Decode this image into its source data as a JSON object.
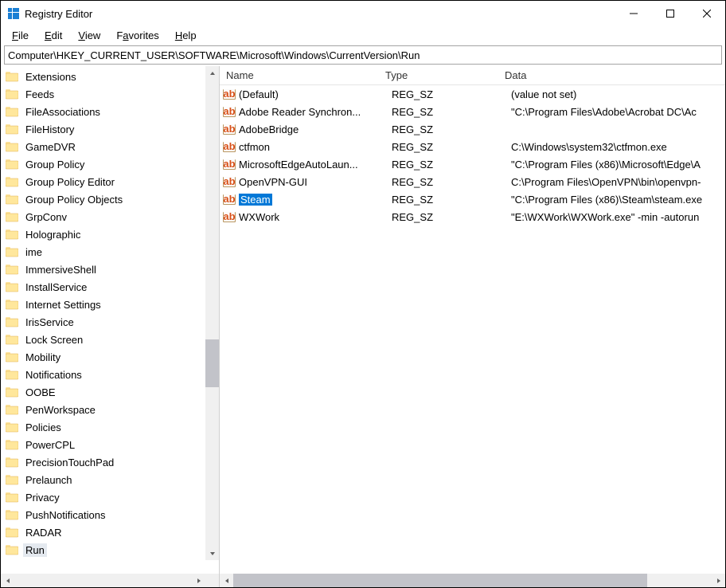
{
  "window": {
    "title": "Registry Editor"
  },
  "menu": {
    "file": "File",
    "edit": "Edit",
    "view": "View",
    "favorites": "Favorites",
    "help": "Help"
  },
  "address": "Computer\\HKEY_CURRENT_USER\\SOFTWARE\\Microsoft\\Windows\\CurrentVersion\\Run",
  "columns": {
    "name": "Name",
    "type": "Type",
    "data": "Data"
  },
  "tree": [
    {
      "label": "Extensions"
    },
    {
      "label": "Feeds"
    },
    {
      "label": "FileAssociations"
    },
    {
      "label": "FileHistory"
    },
    {
      "label": "GameDVR"
    },
    {
      "label": "Group Policy"
    },
    {
      "label": "Group Policy Editor"
    },
    {
      "label": "Group Policy Objects"
    },
    {
      "label": "GrpConv"
    },
    {
      "label": "Holographic"
    },
    {
      "label": "ime"
    },
    {
      "label": "ImmersiveShell"
    },
    {
      "label": "InstallService"
    },
    {
      "label": "Internet Settings"
    },
    {
      "label": "IrisService"
    },
    {
      "label": "Lock Screen"
    },
    {
      "label": "Mobility"
    },
    {
      "label": "Notifications"
    },
    {
      "label": "OOBE"
    },
    {
      "label": "PenWorkspace"
    },
    {
      "label": "Policies"
    },
    {
      "label": "PowerCPL"
    },
    {
      "label": "PrecisionTouchPad"
    },
    {
      "label": "Prelaunch"
    },
    {
      "label": "Privacy"
    },
    {
      "label": "PushNotifications"
    },
    {
      "label": "RADAR"
    },
    {
      "label": "Run",
      "selected": true
    }
  ],
  "values": [
    {
      "name": "(Default)",
      "type": "REG_SZ",
      "data": "(value not set)"
    },
    {
      "name": "Adobe Reader Synchron...",
      "type": "REG_SZ",
      "data": "\"C:\\Program Files\\Adobe\\Acrobat DC\\Ac"
    },
    {
      "name": "AdobeBridge",
      "type": "REG_SZ",
      "data": ""
    },
    {
      "name": "ctfmon",
      "type": "REG_SZ",
      "data": "C:\\Windows\\system32\\ctfmon.exe"
    },
    {
      "name": "MicrosoftEdgeAutoLaun...",
      "type": "REG_SZ",
      "data": "\"C:\\Program Files (x86)\\Microsoft\\Edge\\A"
    },
    {
      "name": "OpenVPN-GUI",
      "type": "REG_SZ",
      "data": "C:\\Program Files\\OpenVPN\\bin\\openvpn-"
    },
    {
      "name": "Steam",
      "type": "REG_SZ",
      "data": "\"C:\\Program Files (x86)\\Steam\\steam.exe",
      "selected": true
    },
    {
      "name": "WXWork",
      "type": "REG_SZ",
      "data": "\"E:\\WXWork\\WXWork.exe\" -min -autorun"
    }
  ]
}
